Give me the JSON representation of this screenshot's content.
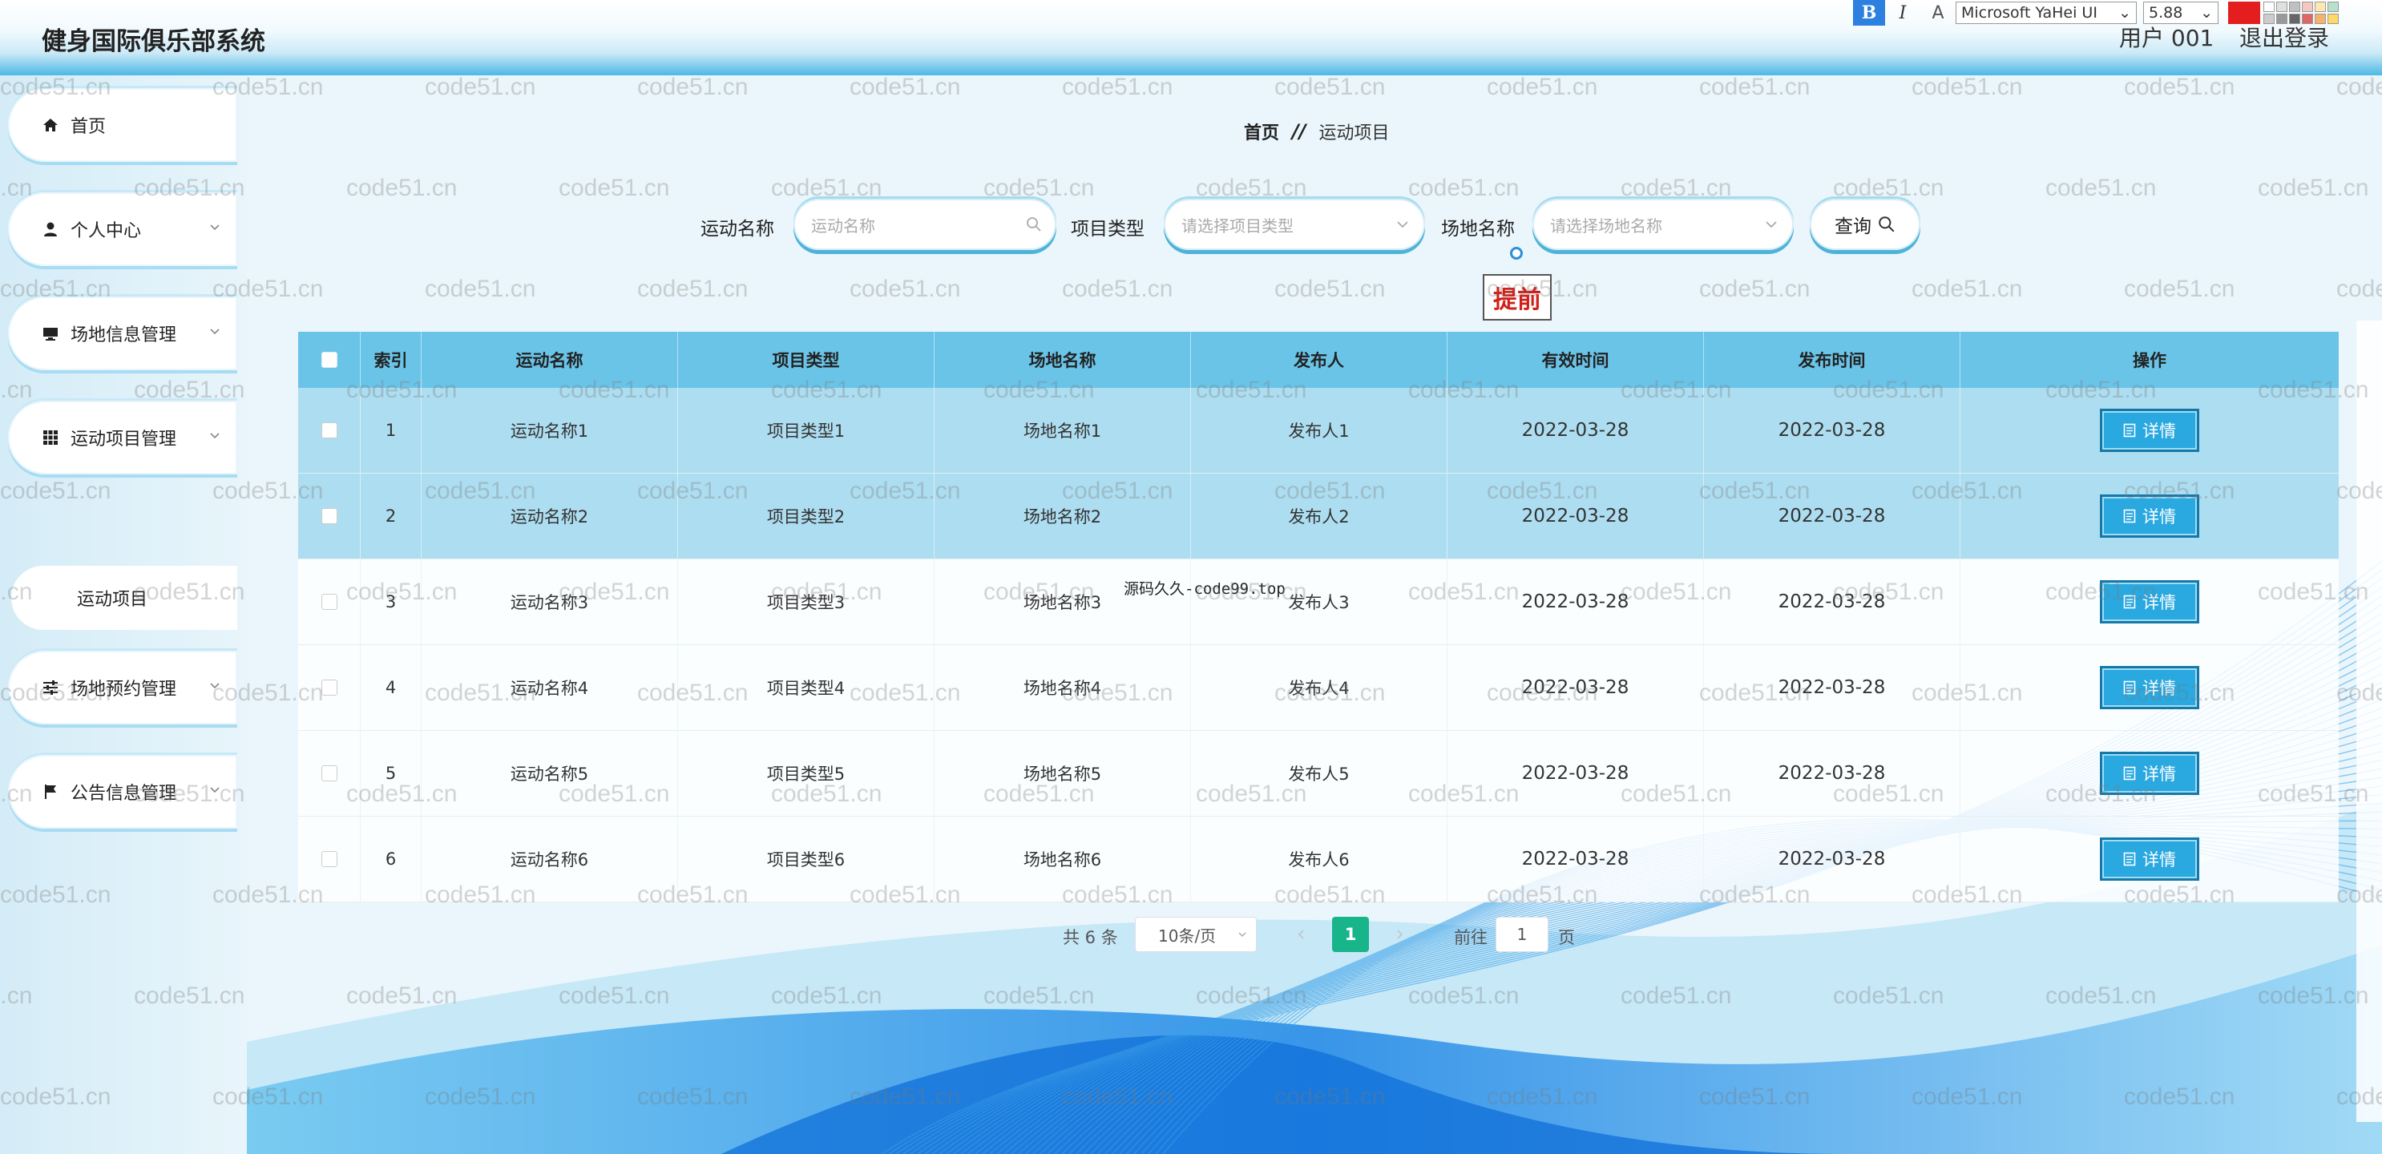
{
  "header": {
    "app_title": "健身国际俱乐部系统",
    "user_label": "用户 001",
    "logout_label": "退出登录"
  },
  "toolbar": {
    "bold": "B",
    "italic": "I",
    "clear": "A",
    "font_family": "Microsoft YaHei UI",
    "font_size": "5.88",
    "active_color": "#e41e1e",
    "palette": [
      "#ffffff",
      "#e0e0e0",
      "#c0c0c0",
      "#f4c7c3",
      "#fce8b2",
      "#b7e1cd",
      "#cccccc",
      "#999999",
      "#666666",
      "#e06666",
      "#f6b26b",
      "#ffd966"
    ]
  },
  "sidebar": {
    "items": [
      {
        "label": "首页",
        "icon": "home-icon"
      },
      {
        "label": "个人中心",
        "icon": "user-icon"
      },
      {
        "label": "场地信息管理",
        "icon": "monitor-icon"
      },
      {
        "label": "运动项目管理",
        "icon": "grid-icon"
      },
      {
        "label": "场地预约管理",
        "icon": "sliders-icon"
      },
      {
        "label": "公告信息管理",
        "icon": "flag-icon"
      }
    ],
    "sub_item": "运动项目"
  },
  "breadcrumb": {
    "home": "首页",
    "separator": "//",
    "current": "运动项目"
  },
  "search": {
    "name_label": "运动名称",
    "name_placeholder": "运动名称",
    "type_label": "项目类型",
    "type_placeholder": "请选择项目类型",
    "venue_label": "场地名称",
    "venue_placeholder": "请选择场地名称",
    "query_label": "查询"
  },
  "overlay": {
    "stamp": "提前",
    "center_watermark": "源码久久-code99.top",
    "watermark": "code51.cn"
  },
  "table": {
    "headers": [
      "索引",
      "运动名称",
      "项目类型",
      "场地名称",
      "发布人",
      "有效时间",
      "发布时间",
      "操作"
    ],
    "detail_label": "详情",
    "rows": [
      {
        "index": "1",
        "name": "运动名称1",
        "type": "项目类型1",
        "venue": "场地名称1",
        "publisher": "发布人1",
        "effective": "2022-03-28",
        "published": "2022-03-28"
      },
      {
        "index": "2",
        "name": "运动名称2",
        "type": "项目类型2",
        "venue": "场地名称2",
        "publisher": "发布人2",
        "effective": "2022-03-28",
        "published": "2022-03-28"
      },
      {
        "index": "3",
        "name": "运动名称3",
        "type": "项目类型3",
        "venue": "场地名称3",
        "publisher": "发布人3",
        "effective": "2022-03-28",
        "published": "2022-03-28"
      },
      {
        "index": "4",
        "name": "运动名称4",
        "type": "项目类型4",
        "venue": "场地名称4",
        "publisher": "发布人4",
        "effective": "2022-03-28",
        "published": "2022-03-28"
      },
      {
        "index": "5",
        "name": "运动名称5",
        "type": "项目类型5",
        "venue": "场地名称5",
        "publisher": "发布人5",
        "effective": "2022-03-28",
        "published": "2022-03-28"
      },
      {
        "index": "6",
        "name": "运动名称6",
        "type": "项目类型6",
        "venue": "场地名称6",
        "publisher": "发布人6",
        "effective": "2022-03-28",
        "published": "2022-03-28"
      }
    ]
  },
  "pagination": {
    "total": "共 6 条",
    "page_size": "10条/页",
    "current_page": "1",
    "goto_label": "前往",
    "goto_value": "1",
    "page_unit": "页"
  },
  "colors": {
    "header_accent": "#4db8e6",
    "table_header": "#6ac4e8",
    "detail_button": "#2aa8e0",
    "current_page": "#18b48a"
  }
}
